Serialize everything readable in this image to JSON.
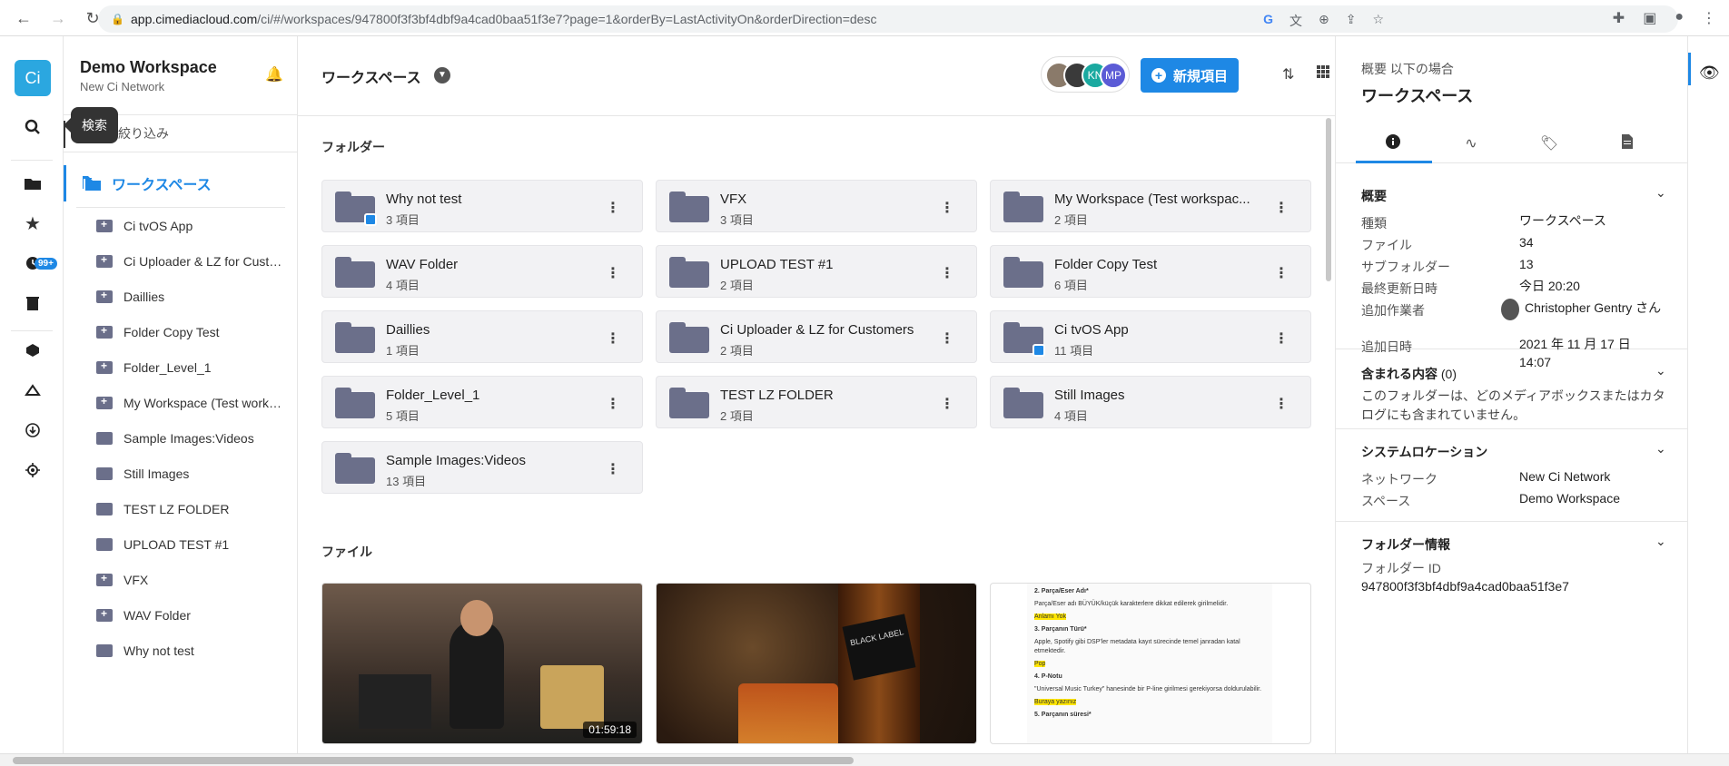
{
  "browser": {
    "url_host": "app.cimediacloud.com",
    "url_rest": "/ci/#/workspaces/947800f3f3bf4dbf9a4cad0baa51f3e7?page=1&orderBy=LastActivityOn&orderDirection=desc"
  },
  "rail": {
    "logo": "Ci",
    "badge": "99+",
    "tooltip": "検索"
  },
  "sidebar": {
    "workspace_title": "Demo Workspace",
    "workspace_sub": "New Ci Network",
    "filter_placeholder": "ードで絞り込み",
    "active_label": "ワークスペース",
    "items": [
      {
        "label": "Ci tvOS App",
        "icon": "folder-shared-icon"
      },
      {
        "label": "Ci Uploader & LZ for Custo...",
        "icon": "folder-shared-icon"
      },
      {
        "label": "Daillies",
        "icon": "folder-shared-icon"
      },
      {
        "label": "Folder Copy Test",
        "icon": "folder-shared-icon"
      },
      {
        "label": "Folder_Level_1",
        "icon": "folder-shared-icon"
      },
      {
        "label": "My Workspace (Test works...",
        "icon": "folder-shared-icon"
      },
      {
        "label": "Sample Images:Videos",
        "icon": "folder-icon"
      },
      {
        "label": "Still Images",
        "icon": "folder-icon"
      },
      {
        "label": "TEST LZ FOLDER",
        "icon": "folder-icon"
      },
      {
        "label": "UPLOAD TEST #1",
        "icon": "folder-icon"
      },
      {
        "label": "VFX",
        "icon": "folder-shared-icon"
      },
      {
        "label": "WAV Folder",
        "icon": "folder-shared-icon"
      },
      {
        "label": "Why not test",
        "icon": "folder-icon"
      }
    ]
  },
  "main": {
    "title": "ワークスペース",
    "avatars": [
      {
        "initials": "",
        "color": "#8a7a6a"
      },
      {
        "initials": "",
        "color": "#3a3a3a"
      },
      {
        "initials": "KN",
        "color": "#1aa9a0"
      },
      {
        "initials": "MP",
        "color": "#5b5bd6"
      }
    ],
    "new_button": "新規項目",
    "folders_label": "フォルダー",
    "files_label": "ファイル",
    "folders": [
      {
        "name": "Why not test",
        "count": "3 項目",
        "shared": true
      },
      {
        "name": "VFX",
        "count": "3 項目",
        "shared": false
      },
      {
        "name": "My Workspace (Test workspac...",
        "count": "2 項目",
        "shared": false
      },
      {
        "name": "WAV Folder",
        "count": "4 項目",
        "shared": false
      },
      {
        "name": "UPLOAD TEST #1",
        "count": "2 項目",
        "shared": false
      },
      {
        "name": "Folder Copy Test",
        "count": "6 項目",
        "shared": false
      },
      {
        "name": "Daillies",
        "count": "1 項目",
        "shared": false
      },
      {
        "name": "Ci Uploader & LZ for Customers",
        "count": "2 項目",
        "shared": false
      },
      {
        "name": "Ci tvOS App",
        "count": "11 項目",
        "shared": true
      },
      {
        "name": "Folder_Level_1",
        "count": "5 項目",
        "shared": false
      },
      {
        "name": "TEST LZ FOLDER",
        "count": "2 項目",
        "shared": false
      },
      {
        "name": "Still Images",
        "count": "4 項目",
        "shared": false
      },
      {
        "name": "Sample Images:Videos",
        "count": "13 項目",
        "shared": false
      }
    ],
    "file_thumbs": {
      "video_duration": "01:59:18",
      "bottle_label": "BLACK LABEL",
      "doc_lines": [
        "2. Parça/Eser Adı*",
        "Parça/Eser adı BÜYÜK/küçük karakterlere dikkat edilerek girilmelidir.",
        "Anlamı Yok",
        "3. Parçanın Türü*",
        "Apple, Spotify gibi DSP'ler metadata kayıt sürecinde temel janradan katal etmektedir.",
        "Pop",
        "4. P-Notu",
        "\"Universal Music Turkey\" hanesinde bir P-line girilmesi gerekiyorsa doldurulabilir.",
        "Buraya yazınız",
        "5. Parçanın süresi*"
      ]
    }
  },
  "panel": {
    "subtitle": "概要 以下の場合",
    "title": "ワークスペース",
    "overview": {
      "heading": "概要",
      "rows": [
        {
          "k": "種類",
          "v": "ワークスペース"
        },
        {
          "k": "ファイル",
          "v": "34"
        },
        {
          "k": "サブフォルダー",
          "v": "13"
        },
        {
          "k": "最終更新日時",
          "v": "今日 20:20"
        },
        {
          "k": "追加作業者",
          "v": "Christopher Gentry さん"
        },
        {
          "k": "追加日時",
          "v": "2021 年 11 月 17 日 14:07"
        }
      ]
    },
    "contents": {
      "heading": "含まれる内容",
      "count": "(0)",
      "text": "このフォルダーは、どのメディアボックスまたはカタログにも含まれていません。"
    },
    "system": {
      "heading": "システムロケーション",
      "rows": [
        {
          "k": "ネットワーク",
          "v": "New Ci Network"
        },
        {
          "k": "スペース",
          "v": "Demo Workspace"
        }
      ]
    },
    "folder_info": {
      "heading": "フォルダー情報",
      "id_label": "フォルダー ID",
      "id_value": "947800f3f3bf4dbf9a4cad0baa51f3e7"
    }
  },
  "colors": {
    "accent": "#1e88e5",
    "folder": "#6b6f8a",
    "logo": "#2ba7e0"
  }
}
